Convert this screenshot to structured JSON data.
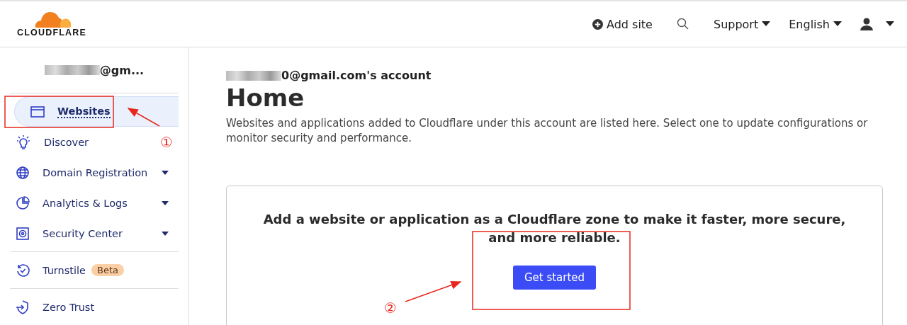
{
  "header": {
    "logo": "CLOUDFLARE",
    "add_site": "Add site",
    "support": "Support",
    "language": "English"
  },
  "sidebar": {
    "account": "@gm...",
    "sections": [
      {
        "items": [
          {
            "label": "Websites",
            "selected": true,
            "has_menu": false
          },
          {
            "label": "Discover",
            "selected": false,
            "has_menu": false
          },
          {
            "label": "Domain Registration",
            "selected": false,
            "has_menu": true
          },
          {
            "label": "Analytics & Logs",
            "selected": false,
            "has_menu": true
          },
          {
            "label": "Security Center",
            "selected": false,
            "has_menu": true
          }
        ]
      },
      {
        "items": [
          {
            "label": "Turnstile",
            "selected": false,
            "has_menu": false,
            "badge": "Beta"
          }
        ]
      },
      {
        "items": [
          {
            "label": "Zero Trust",
            "selected": false,
            "has_menu": false
          }
        ]
      }
    ]
  },
  "main": {
    "account": "0@gmail.com's account",
    "title": "Home",
    "description": "Websites and applications added to Cloudflare under this account are listed here. Select one to update configurations or monitor security and performance.",
    "card": {
      "heading": "Add a website or application as a Cloudflare zone to make it faster, more secure, and more reliable.",
      "button": "Get started"
    }
  },
  "annotations": [
    {
      "label": "①"
    },
    {
      "label": "②"
    }
  ]
}
